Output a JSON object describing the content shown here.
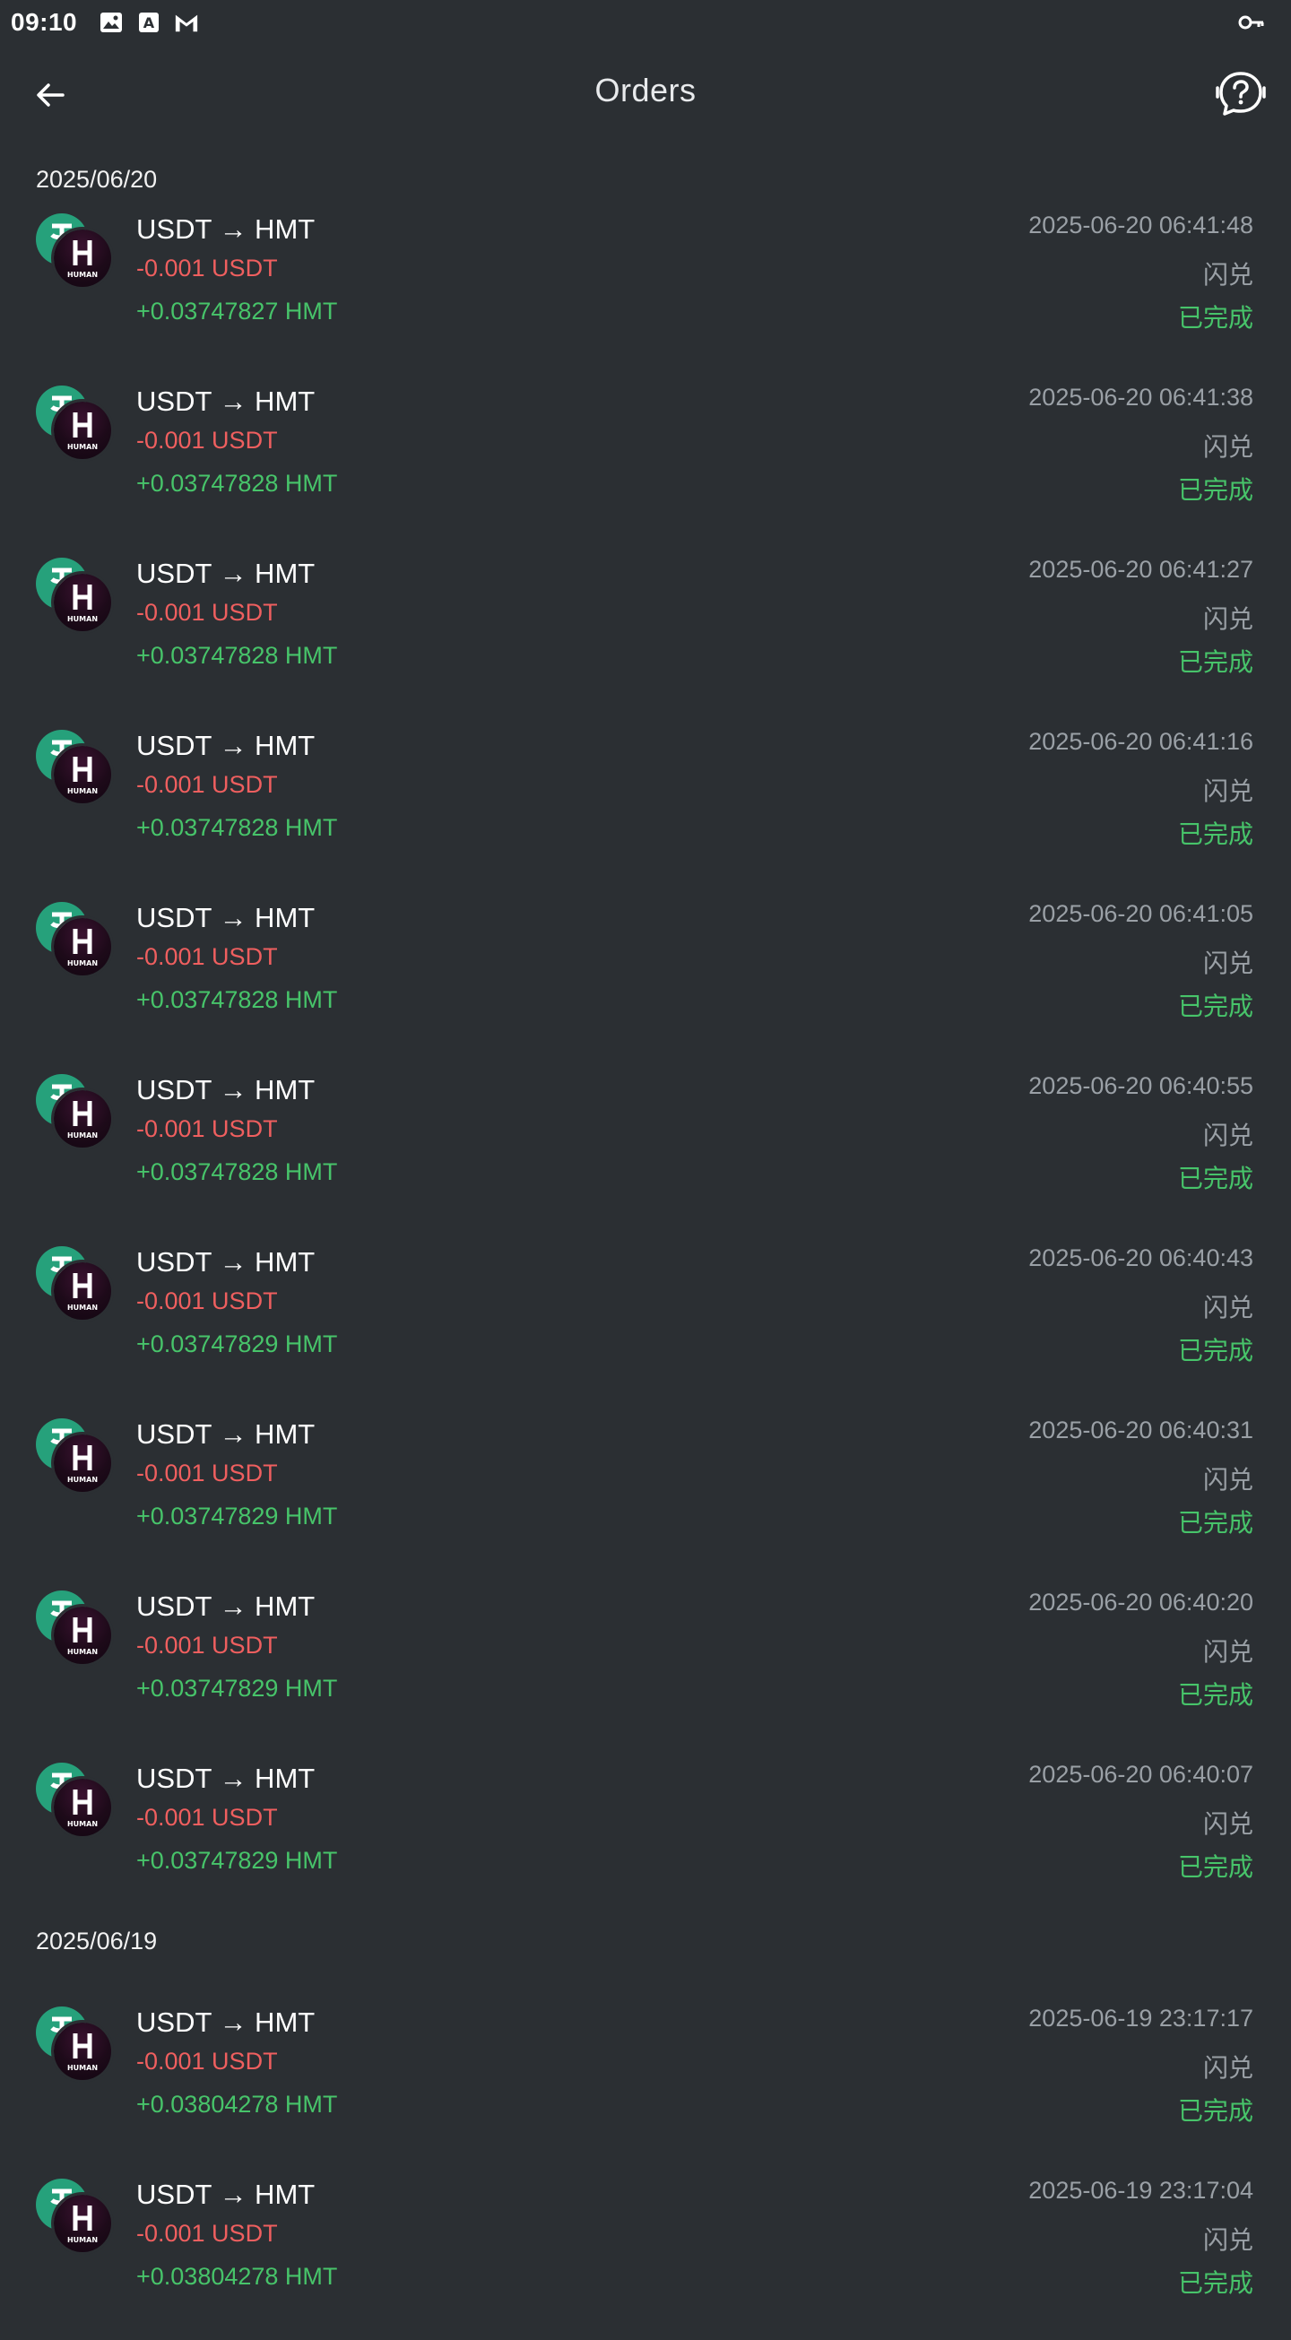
{
  "status_bar": {
    "time": "09:10",
    "icons": [
      "image-icon",
      "font-app-icon",
      "gmail-icon"
    ],
    "right_icon": "key-icon"
  },
  "app_bar": {
    "title": "Orders",
    "back_icon": "arrow-left-icon",
    "help_icon": "help-chat-icon"
  },
  "groups": [
    {
      "date": "2025/06/20",
      "orders": [
        {
          "pair": "USDT → HMT",
          "sent": "-0.001 USDT",
          "received": "+0.03747827 HMT",
          "datetime": "2025-06-20 06:41:48",
          "type": "闪兑",
          "status": "已完成"
        },
        {
          "pair": "USDT → HMT",
          "sent": "-0.001 USDT",
          "received": "+0.03747828 HMT",
          "datetime": "2025-06-20 06:41:38",
          "type": "闪兑",
          "status": "已完成"
        },
        {
          "pair": "USDT → HMT",
          "sent": "-0.001 USDT",
          "received": "+0.03747828 HMT",
          "datetime": "2025-06-20 06:41:27",
          "type": "闪兑",
          "status": "已完成"
        },
        {
          "pair": "USDT → HMT",
          "sent": "-0.001 USDT",
          "received": "+0.03747828 HMT",
          "datetime": "2025-06-20 06:41:16",
          "type": "闪兑",
          "status": "已完成"
        },
        {
          "pair": "USDT → HMT",
          "sent": "-0.001 USDT",
          "received": "+0.03747828 HMT",
          "datetime": "2025-06-20 06:41:05",
          "type": "闪兑",
          "status": "已完成"
        },
        {
          "pair": "USDT → HMT",
          "sent": "-0.001 USDT",
          "received": "+0.03747828 HMT",
          "datetime": "2025-06-20 06:40:55",
          "type": "闪兑",
          "status": "已完成"
        },
        {
          "pair": "USDT → HMT",
          "sent": "-0.001 USDT",
          "received": "+0.03747829 HMT",
          "datetime": "2025-06-20 06:40:43",
          "type": "闪兑",
          "status": "已完成"
        },
        {
          "pair": "USDT → HMT",
          "sent": "-0.001 USDT",
          "received": "+0.03747829 HMT",
          "datetime": "2025-06-20 06:40:31",
          "type": "闪兑",
          "status": "已完成"
        },
        {
          "pair": "USDT → HMT",
          "sent": "-0.001 USDT",
          "received": "+0.03747829 HMT",
          "datetime": "2025-06-20 06:40:20",
          "type": "闪兑",
          "status": "已完成"
        },
        {
          "pair": "USDT → HMT",
          "sent": "-0.001 USDT",
          "received": "+0.03747829 HMT",
          "datetime": "2025-06-20 06:40:07",
          "type": "闪兑",
          "status": "已完成"
        }
      ]
    },
    {
      "date": "2025/06/19",
      "orders": [
        {
          "pair": "USDT → HMT",
          "sent": "-0.001 USDT",
          "received": "+0.03804278 HMT",
          "datetime": "2025-06-19 23:17:17",
          "type": "闪兑",
          "status": "已完成"
        },
        {
          "pair": "USDT → HMT",
          "sent": "-0.001 USDT",
          "received": "+0.03804278 HMT",
          "datetime": "2025-06-19 23:17:04",
          "type": "闪兑",
          "status": "已完成"
        }
      ]
    }
  ],
  "coin_labels": {
    "hmt_caption": "HUMAN"
  },
  "colors": {
    "background": "#2b2f33",
    "negative": "#ef5f5f",
    "positive": "#47c46a",
    "muted": "#9aa0a6",
    "usdt": "#26a17b"
  }
}
